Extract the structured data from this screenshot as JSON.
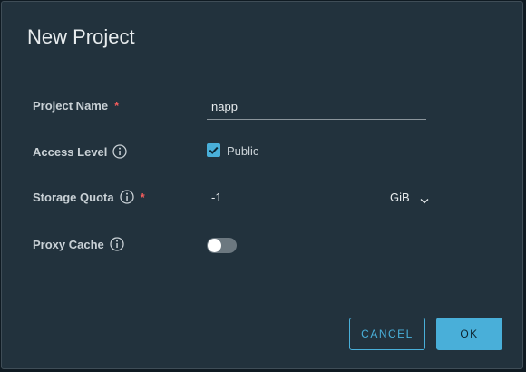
{
  "dialog": {
    "title": "New Project"
  },
  "form": {
    "project_name": {
      "label": "Project Name",
      "required_mark": "*",
      "value": "napp"
    },
    "access_level": {
      "label": "Access Level",
      "checkbox_label": "Public",
      "checked": true
    },
    "storage_quota": {
      "label": "Storage Quota",
      "required_mark": "*",
      "value": "-1",
      "unit": "GiB"
    },
    "proxy_cache": {
      "label": "Proxy Cache",
      "enabled": false
    }
  },
  "buttons": {
    "cancel": "CANCEL",
    "ok": "OK"
  },
  "icons": {
    "info": "info-icon",
    "check": "check-icon",
    "chevron": "chevron-down-icon"
  },
  "colors": {
    "accent": "#49afd9",
    "required": "#f35c5c",
    "modal_bg": "#22323d"
  }
}
